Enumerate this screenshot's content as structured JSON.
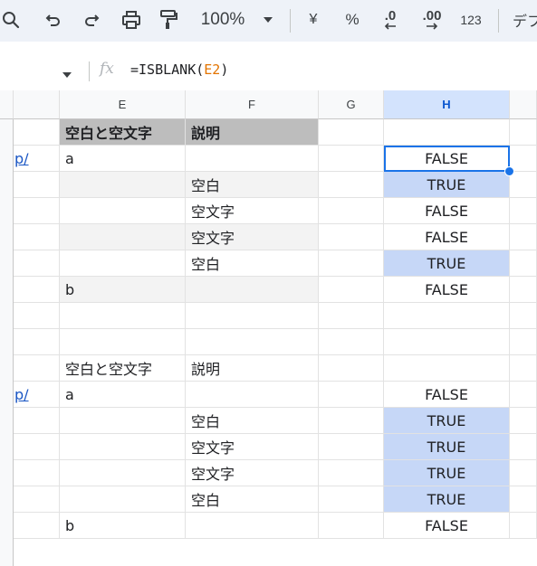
{
  "toolbar": {
    "zoom": "100%",
    "currency": "¥",
    "percent": "%",
    "dec_decrease": ".0",
    "dec_increase": ".00",
    "number_format": "123",
    "font_partial": "デフ"
  },
  "formula_bar": {
    "formula_prefix": "=ISBLANK(",
    "formula_ref": "E2",
    "formula_suffix": ")"
  },
  "colors": {
    "ref_color": "#e37400",
    "selection": "#1a73e8",
    "true_fill": "#c6d7f7",
    "header_fill": "#bdbdbd"
  },
  "columns": {
    "e": "E",
    "f": "F",
    "g": "G",
    "h": "H"
  },
  "rows": [
    {
      "d": "",
      "e": "空白と空文字",
      "f": "説明",
      "h": ""
    },
    {
      "d": "p/",
      "e": "a",
      "f": "",
      "h": "FALSE"
    },
    {
      "d": "",
      "e": "",
      "f": "空白",
      "h": "TRUE"
    },
    {
      "d": "",
      "e": "",
      "f": "空文字",
      "h": "FALSE"
    },
    {
      "d": "",
      "e": "",
      "f": "空文字",
      "h": "FALSE"
    },
    {
      "d": "",
      "e": "",
      "f": "空白",
      "h": "TRUE"
    },
    {
      "d": "",
      "e": "b",
      "f": "",
      "h": "FALSE"
    },
    {
      "d": "",
      "e": "",
      "f": "",
      "h": ""
    },
    {
      "d": "",
      "e": "",
      "f": "",
      "h": ""
    },
    {
      "d": "",
      "e": "空白と空文字",
      "f": "説明",
      "h": ""
    },
    {
      "d": "p/",
      "e": "a",
      "f": "",
      "h": "FALSE"
    },
    {
      "d": "",
      "e": "",
      "f": "空白",
      "h": "TRUE"
    },
    {
      "d": "",
      "e": "",
      "f": "空文字",
      "h": "TRUE"
    },
    {
      "d": "",
      "e": "",
      "f": "空文字",
      "h": "TRUE"
    },
    {
      "d": "",
      "e": "",
      "f": "空白",
      "h": "TRUE"
    },
    {
      "d": "",
      "e": "b",
      "f": "",
      "h": "FALSE"
    }
  ]
}
